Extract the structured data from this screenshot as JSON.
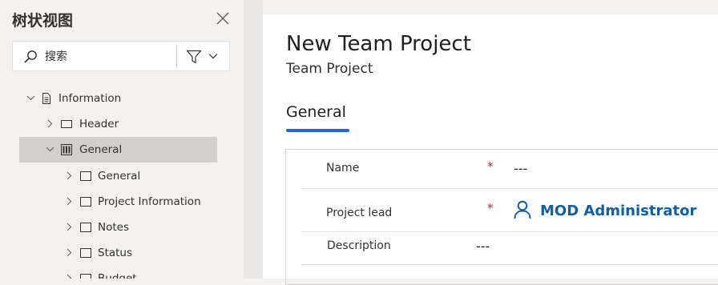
{
  "tree_panel": {
    "title": "树状视图",
    "search": {
      "placeholder": "搜索",
      "value": ""
    },
    "items": [
      {
        "label": "Information"
      },
      {
        "label": "Header"
      },
      {
        "label": "General"
      },
      {
        "label": "General"
      },
      {
        "label": "Project Information"
      },
      {
        "label": "Notes"
      },
      {
        "label": "Status"
      },
      {
        "label": "Budget"
      }
    ]
  },
  "form": {
    "title": "New Team Project",
    "subtitle": "Team Project",
    "tab": "General",
    "fields": [
      {
        "label": "Name",
        "required": "*",
        "value": "---"
      },
      {
        "label": "Project lead",
        "required": "*",
        "value": "MOD Administrator"
      },
      {
        "label": "Description",
        "value": "---"
      }
    ]
  },
  "colors": {
    "accent": "#2266e3",
    "link": "#115ea3",
    "required": "#c4262e",
    "selected_row": "#d2d0ce"
  },
  "icons": [
    "close-icon",
    "search-icon",
    "filter-icon",
    "chevron-down-icon",
    "chevron-right-icon",
    "document-icon",
    "rectangle-icon",
    "section-grid-icon",
    "person-icon"
  ]
}
